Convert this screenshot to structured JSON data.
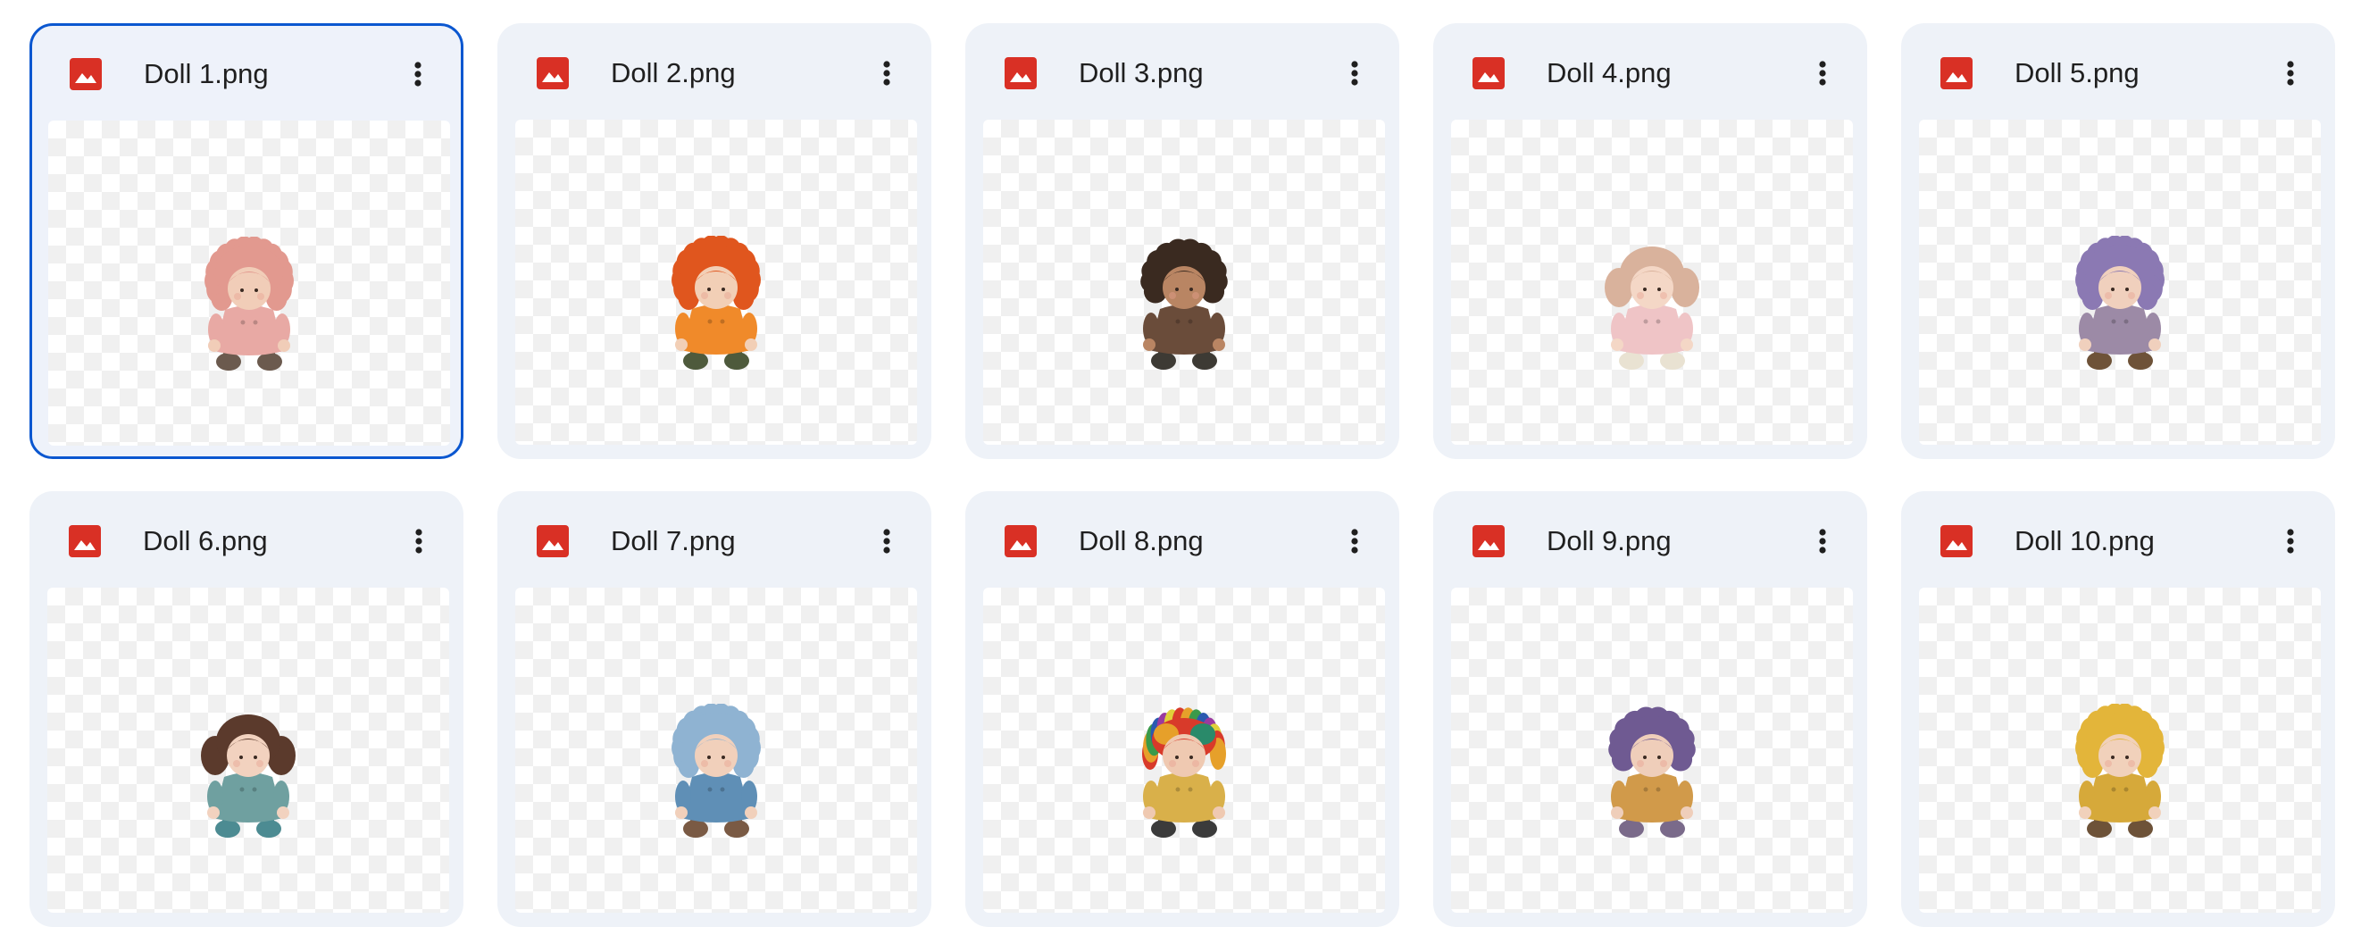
{
  "files": [
    {
      "name": "Doll 1.png",
      "selected": true,
      "hair": "#e2998f",
      "hair_style": "fluffy",
      "dress": "#e8a9a4",
      "legs": "#6b5a4e",
      "skin": "#f1cdb8"
    },
    {
      "name": "Doll 2.png",
      "selected": false,
      "hair": "#e0561e",
      "hair_style": "fluffy",
      "dress": "#f08a2a",
      "legs": "#4e5a3c",
      "skin": "#f2cfb6"
    },
    {
      "name": "Doll 3.png",
      "selected": false,
      "hair": "#3a2a20",
      "hair_style": "curly",
      "dress": "#6a4c3a",
      "legs": "#3d3a34",
      "skin": "#b98563"
    },
    {
      "name": "Doll 4.png",
      "selected": false,
      "hair": "#d9b29c",
      "hair_style": "pigtails",
      "dress": "#efc4c6",
      "legs": "#e9e2d2",
      "skin": "#f4d7c6"
    },
    {
      "name": "Doll 5.png",
      "selected": false,
      "hair": "#8b79b3",
      "hair_style": "fluffy",
      "dress": "#9c8aa6",
      "legs": "#6e5238",
      "skin": "#f0d0bd"
    },
    {
      "name": "Doll 6.png",
      "selected": false,
      "hair": "#5b3a2c",
      "hair_style": "pigtails",
      "dress": "#6fa0a0",
      "legs": "#4c8b92",
      "skin": "#f2d2bf"
    },
    {
      "name": "Doll 7.png",
      "selected": false,
      "hair": "#8fb3d2",
      "hair_style": "fluffy",
      "dress": "#5f8fb6",
      "legs": "#7a5a44",
      "skin": "#f1d0bb"
    },
    {
      "name": "Doll 8.png",
      "selected": false,
      "hair": "#d83a2a",
      "hair_style": "rainbow",
      "dress": "#d9b04a",
      "legs": "#3b3b3b",
      "skin": "#efc9b1"
    },
    {
      "name": "Doll 9.png",
      "selected": false,
      "hair": "#6f5a92",
      "hair_style": "curly",
      "dress": "#d19a4a",
      "legs": "#7a6a8a",
      "skin": "#efceba"
    },
    {
      "name": "Doll 10.png",
      "selected": false,
      "hair": "#e3b53a",
      "hair_style": "fluffy",
      "dress": "#d6a93a",
      "legs": "#6d5238",
      "skin": "#f1d1bb"
    }
  ],
  "icons": {
    "file_type": "image-file-icon",
    "more": "more-vert-icon"
  },
  "colors": {
    "file_icon": "#d93025",
    "selected_border": "#0b57d0",
    "card_bg": "#eef2f8"
  }
}
